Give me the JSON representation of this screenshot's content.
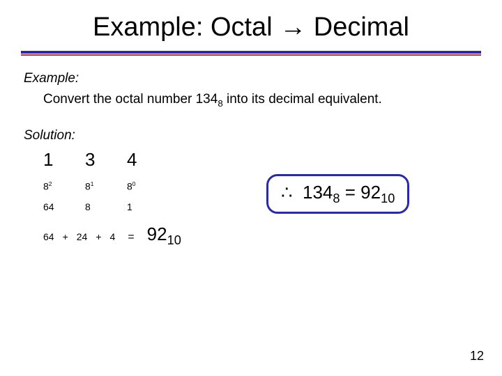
{
  "title": "Example: Octal → Decimal",
  "exampleLabel": "Example:",
  "prompt": {
    "pre": "Convert the octal number 1348",
    "post": " into its decimal equivalent."
  },
  "solutionLabel": "Solution:",
  "digits": {
    "d2": "1",
    "d1": "3",
    "d0": "4"
  },
  "powers": {
    "p2b": "8",
    "p2e": "2",
    "p1b": "8",
    "p1e": "1",
    "p0b": "8",
    "p0e": "0"
  },
  "weights": {
    "w2": "64",
    "w1": "8",
    "w0": "1"
  },
  "sum": {
    "t2": "64",
    "op1": "+",
    "t1": "24",
    "op2": "+",
    "t0": "4",
    "eq": "=",
    "resB": "92",
    "resS": "10"
  },
  "therefore": {
    "sym": "∴",
    "lhsB": "134",
    "lhsS": "8",
    "mid": " = ",
    "rhsB": "92",
    "rhsS": "10"
  },
  "page": "12"
}
